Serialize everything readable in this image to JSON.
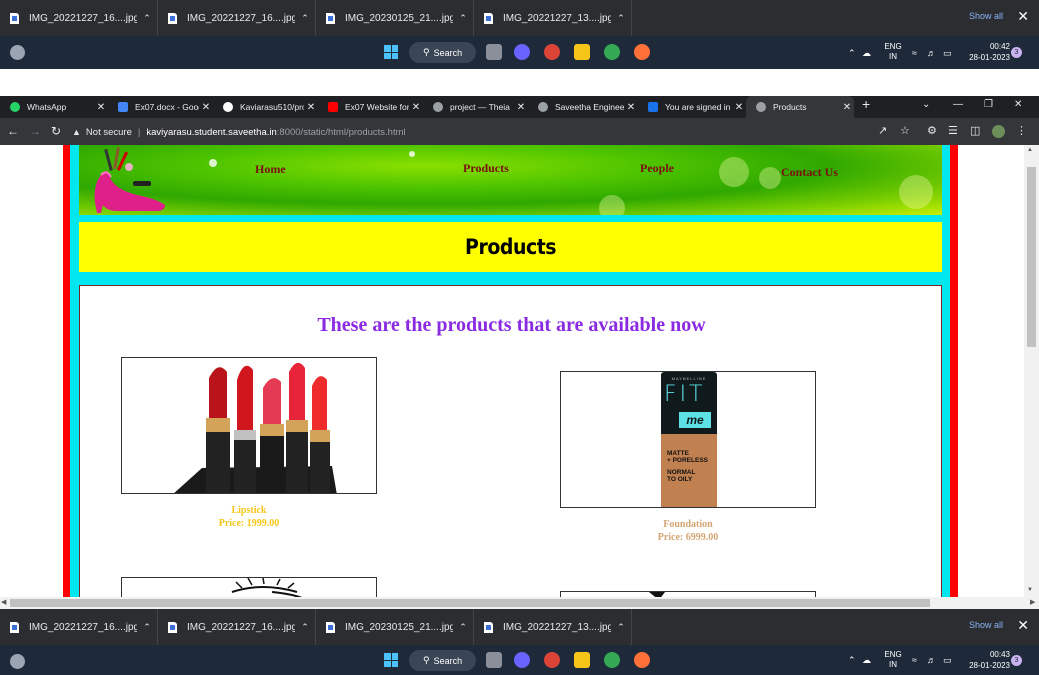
{
  "downloads_top": {
    "items": [
      {
        "name": "IMG_20221227_16....jpg"
      },
      {
        "name": "IMG_20221227_16....jpg"
      },
      {
        "name": "IMG_20230125_21....jpg"
      },
      {
        "name": "IMG_20221227_13....jpg"
      }
    ],
    "show_all": "Show all"
  },
  "taskbar_top": {
    "search": "Search",
    "lang_1": "ENG",
    "lang_2": "IN",
    "time": "00:42",
    "date": "28-01-2023",
    "notifications": "3"
  },
  "browser": {
    "tabs": [
      {
        "label": "WhatsApp",
        "color": "#25d366"
      },
      {
        "label": "Ex07.docx - Goog",
        "color": "#4285f4"
      },
      {
        "label": "Kaviarasu510/pro",
        "color": "#ffffff"
      },
      {
        "label": "Ex07 Website for",
        "color": "#ff0000"
      },
      {
        "label": "project — Theia",
        "color": "#9aa0a6"
      },
      {
        "label": "Saveetha Enginee",
        "color": "#9aa0a6"
      },
      {
        "label": "You are signed in",
        "color": "#1a73e8"
      },
      {
        "label": "Products",
        "color": "#9aa0a6"
      }
    ],
    "not_secure": "Not secure",
    "url_host": "kaviyarasu.student.saveetha.in",
    "url_path": ":8000/static/html/products.html"
  },
  "site": {
    "nav": [
      "Home",
      "Products",
      "People",
      "Contact Us"
    ],
    "page_title": "Products",
    "heading": "These are the products that are available now",
    "products": [
      {
        "name": "Lipstick",
        "price": "Price: 1999.00",
        "color": "#f5c518"
      },
      {
        "name": "Foundation",
        "price": "Price: 6999.00",
        "color": "#d4a574"
      }
    ],
    "foundation_label": {
      "brand": "MAYBELLINE",
      "line1": "FIT",
      "line2": "me",
      "line3": "MATTE",
      "line4": "+ PORELESS",
      "line5": "NORMAL",
      "line6": "TO OILY"
    }
  },
  "downloads_bottom": {
    "items": [
      {
        "name": "IMG_20221227_16....jpg"
      },
      {
        "name": "IMG_20221227_16....jpg"
      },
      {
        "name": "IMG_20230125_21....jpg"
      },
      {
        "name": "IMG_20221227_13....jpg"
      }
    ],
    "show_all": "Show all"
  },
  "taskbar_bottom": {
    "search": "Search",
    "lang_1": "ENG",
    "lang_2": "IN",
    "time": "00:43",
    "date": "28-01-2023",
    "notifications": "3"
  }
}
